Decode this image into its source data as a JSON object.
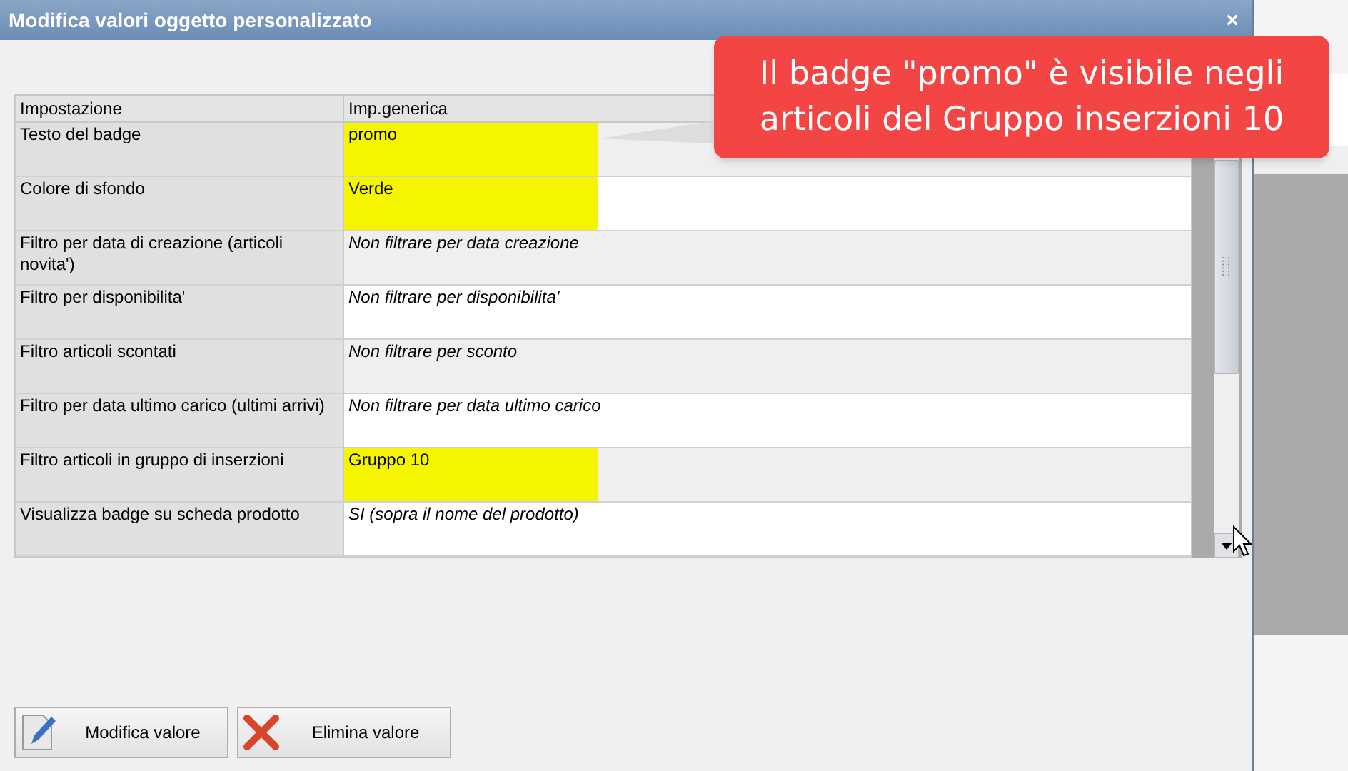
{
  "window": {
    "title": "Modifica valori oggetto personalizzato",
    "close": "×"
  },
  "table": {
    "columns": [
      "Impostazione",
      "Imp.generica"
    ],
    "rows": [
      {
        "setting": "Testo del badge",
        "value": "promo",
        "italic": false,
        "highlighted": true
      },
      {
        "setting": "Colore di sfondo",
        "value": "Verde",
        "italic": false,
        "highlighted": true
      },
      {
        "setting": "Filtro per data di creazione (articoli novita')",
        "value": "Non filtrare per data creazione",
        "italic": true,
        "highlighted": false
      },
      {
        "setting": "Filtro per disponibilita'",
        "value": "Non filtrare per disponibilita'",
        "italic": true,
        "highlighted": false
      },
      {
        "setting": "Filtro articoli scontati",
        "value": "Non filtrare per sconto",
        "italic": true,
        "highlighted": false
      },
      {
        "setting": "Filtro per data ultimo carico (ultimi arrivi)",
        "value": "Non filtrare per data ultimo carico",
        "italic": true,
        "highlighted": false
      },
      {
        "setting": "Filtro articoli in gruppo di inserzioni",
        "value": "Gruppo 10",
        "italic": false,
        "highlighted": true
      },
      {
        "setting": "Visualizza badge su scheda prodotto",
        "value": "SI (sopra il nome del prodotto)",
        "italic": true,
        "highlighted": false
      }
    ]
  },
  "buttons": [
    {
      "kind": "edit",
      "label": "Modifica valore"
    },
    {
      "kind": "delete",
      "label": "Elimina valore"
    }
  ],
  "callout": {
    "text": "Il badge \"promo\" è visibile negli articoli del Gruppo inserzioni 10"
  }
}
